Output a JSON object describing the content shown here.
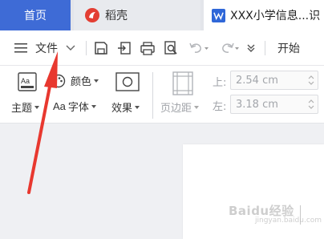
{
  "tabs": {
    "home": "首页",
    "daoke": "稻壳",
    "document": "XXX小学信息...识"
  },
  "toolbar": {
    "file_menu": "文件",
    "start_tab": "开始"
  },
  "ribbon": {
    "theme": "主题",
    "color": "颜色",
    "font": "字体",
    "effect": "效果",
    "margin": "页边距",
    "top_label": "上:",
    "top_value": "2.54 cm",
    "left_label": "左:",
    "left_value": "3.18 cm"
  },
  "watermark": {
    "text": "Baidu经验",
    "sub": "jingyan.baidu.com"
  },
  "colors": {
    "home_tab": "#3e6bd6",
    "annotation_arrow": "#e8382f",
    "word_logo": "#2f67d8",
    "daoke_logo": "#e33e33"
  }
}
